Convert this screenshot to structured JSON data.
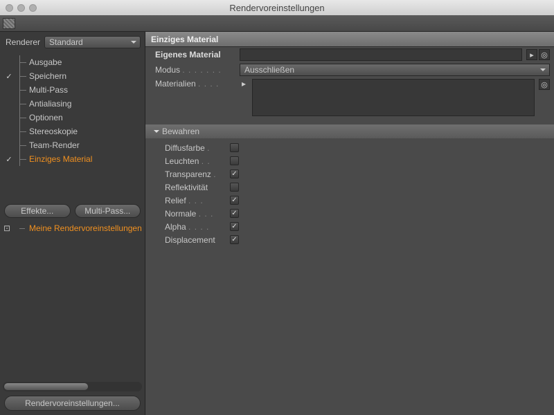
{
  "window": {
    "title": "Rendervoreinstellungen"
  },
  "left": {
    "renderer_label": "Renderer",
    "renderer_value": "Standard",
    "tree": [
      {
        "label": "Ausgabe",
        "checked": ""
      },
      {
        "label": "Speichern",
        "checked": "✓"
      },
      {
        "label": "Multi-Pass",
        "checked": ""
      },
      {
        "label": "Antialiasing",
        "checked": ""
      },
      {
        "label": "Optionen",
        "checked": ""
      },
      {
        "label": "Stereoskopie",
        "checked": ""
      },
      {
        "label": "Team-Render",
        "checked": ""
      },
      {
        "label": "Einziges Material",
        "checked": "✓",
        "selected": true
      }
    ],
    "effects_btn": "Effekte...",
    "multipass_btn": "Multi-Pass...",
    "preset_label": "Meine Rendervoreinstellungen",
    "big_btn": "Rendervoreinstellungen..."
  },
  "panel": {
    "title": "Einziges Material",
    "own_material_label": "Eigenes Material",
    "mode_label": "Modus",
    "mode_value": "Ausschließen",
    "materials_label": "Materialien",
    "preserve_header": "Bewahren",
    "checks": [
      {
        "label": "Diffusfarbe",
        "checked": false
      },
      {
        "label": "Leuchten",
        "checked": false
      },
      {
        "label": "Transparenz",
        "checked": true
      },
      {
        "label": "Reflektivität",
        "checked": false
      },
      {
        "label": "Relief",
        "checked": true
      },
      {
        "label": "Normale",
        "checked": true
      },
      {
        "label": "Alpha",
        "checked": true
      },
      {
        "label": "Displacement",
        "checked": true
      }
    ]
  }
}
